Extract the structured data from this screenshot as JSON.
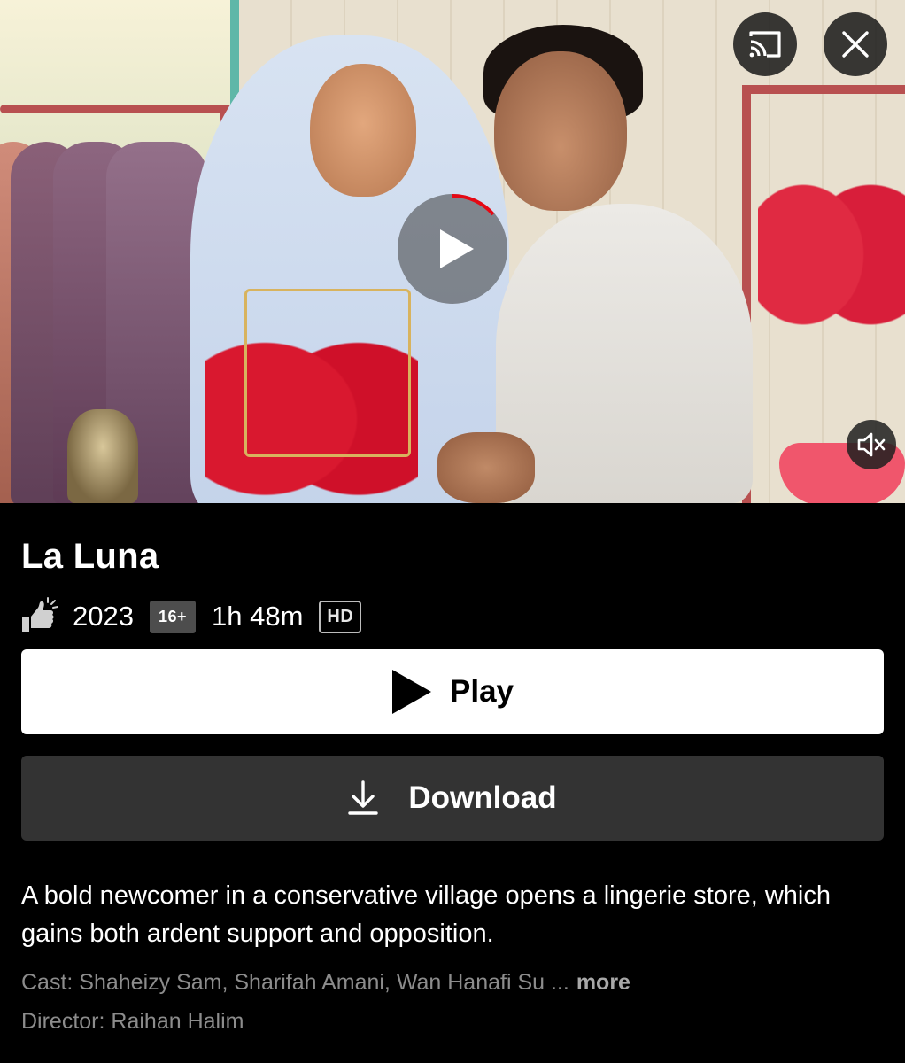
{
  "header": {
    "cast_icon": "cast-icon",
    "close_icon": "close-icon",
    "mute_icon": "volume-muted-icon",
    "center_play_icon": "play-icon"
  },
  "title": "La Luna",
  "meta": {
    "thumbs_icon": "thumbs-up-icon",
    "year": "2023",
    "maturity_rating": "16+",
    "duration": "1h 48m",
    "quality": "HD"
  },
  "actions": {
    "play_label": "Play",
    "download_label": "Download"
  },
  "description": "A bold newcomer in a conservative village opens a lingerie store, which gains both ardent support and opposition.",
  "credits": {
    "cast": "Cast: Shaheizy Sam, Sharifah Amani, Wan Hanafi Su",
    "ellipsis": "...",
    "more_label": "more",
    "director": "Director: Raihan Halim"
  },
  "colors": {
    "background": "#000000",
    "play_button": "#ffffff",
    "download_button": "#333333",
    "progress_ring": "#e50914",
    "muted_text": "#8c8c8c"
  }
}
